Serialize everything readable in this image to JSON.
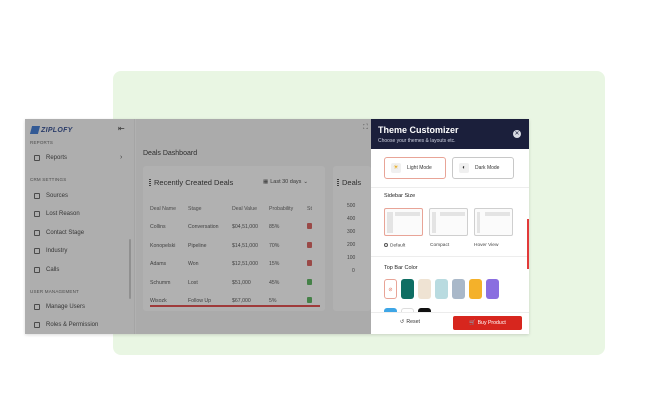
{
  "sidebar": {
    "logo_text": "ZIPLOFY",
    "sections": [
      {
        "key": "reports",
        "label": "REPORTS"
      },
      {
        "key": "crm",
        "label": "CRM SETTINGS"
      },
      {
        "key": "users",
        "label": "USER MANAGEMENT"
      }
    ],
    "items": [
      {
        "key": "reports",
        "label": "Reports"
      },
      {
        "key": "sources",
        "label": "Sources"
      },
      {
        "key": "lost-reason",
        "label": "Lost Reason"
      },
      {
        "key": "contact-stage",
        "label": "Contact Stage"
      },
      {
        "key": "industry",
        "label": "Industry"
      },
      {
        "key": "calls",
        "label": "Calls"
      },
      {
        "key": "manage-users",
        "label": "Manage Users"
      },
      {
        "key": "roles",
        "label": "Roles & Permission"
      }
    ]
  },
  "main": {
    "title": "Deals Dashboard",
    "deals_card": {
      "title": "Recently Created Deals",
      "period": "Last 30 days",
      "columns": [
        "Deal Name",
        "Stage",
        "Deal Value",
        "Probability",
        "St"
      ],
      "rows": [
        {
          "name": "Collins",
          "stage": "Conversation",
          "value": "$04,51,000",
          "prob": "85%",
          "status_color": "#d9534f"
        },
        {
          "name": "Konopelski",
          "stage": "Pipeline",
          "value": "$14,51,000",
          "prob": "70%",
          "status_color": "#d9534f"
        },
        {
          "name": "Adams",
          "stage": "Won",
          "value": "$12,51,000",
          "prob": "15%",
          "status_color": "#d9534f"
        },
        {
          "name": "Schumm",
          "stage": "Lost",
          "value": "$51,000",
          "prob": "45%",
          "status_color": "#4caf50"
        },
        {
          "name": "Wisozk",
          "stage": "Follow Up",
          "value": "$67,000",
          "prob": "5%",
          "status_color": "#4caf50"
        }
      ]
    },
    "second_card": {
      "title": "Deals",
      "axis": [
        "500",
        "400",
        "300",
        "200",
        "100",
        "0"
      ]
    }
  },
  "customizer": {
    "title": "Theme Customizer",
    "subtitle": "Choose your themes & layouts etc.",
    "modes": {
      "light": "Light Mode",
      "dark": "Dark Mode"
    },
    "sidebar_size": {
      "title": "Sidebar Size",
      "options": [
        "Default",
        "Compact",
        "Hover View"
      ]
    },
    "topbar": {
      "title": "Top Bar Color",
      "swatches": [
        "#ffffff",
        "#0f6e63",
        "#efe3d3",
        "#b9dbe0",
        "#a9b8c9",
        "#f4b12a",
        "#8a6ee0"
      ],
      "swatches_row2": [
        "#3ea6e6",
        "#ffffff",
        "#111111"
      ]
    },
    "footer": {
      "reset": "Reset",
      "buy": "Buy Product"
    }
  },
  "colors": {
    "accent": "#d7261e",
    "header_bg": "#1b1f3b",
    "panel_bg": "#e9f6e3"
  }
}
